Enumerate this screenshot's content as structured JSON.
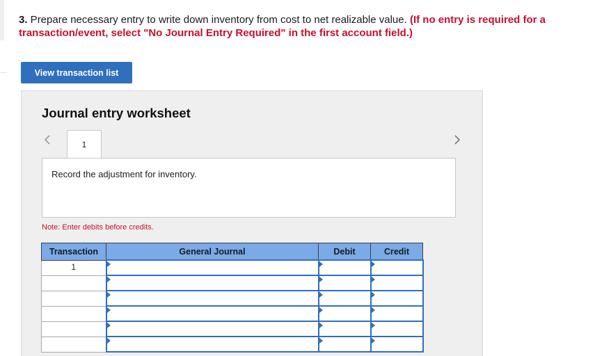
{
  "question": {
    "number": "3.",
    "text": " Prepare necessary entry to write down inventory from cost to net realizable value. ",
    "instruction": "(If no entry is required for a transaction/event, select \"No Journal Entry Required\" in the first account field.)"
  },
  "view_button": {
    "label": "View transaction list"
  },
  "worksheet": {
    "title": "Journal entry worksheet",
    "nav_prev_icon": "chevron-left-icon",
    "nav_next_icon": "chevron-right-icon",
    "active_tab": "1",
    "description": "Record the adjustment for inventory.",
    "note": "Note: Enter debits before credits.",
    "table": {
      "headers": {
        "transaction": "Transaction",
        "journal": "General Journal",
        "debit": "Debit",
        "credit": "Credit"
      },
      "rows": [
        {
          "transaction": "1",
          "account": "",
          "debit": "",
          "credit": ""
        },
        {
          "transaction": "",
          "account": "",
          "debit": "",
          "credit": ""
        },
        {
          "transaction": "",
          "account": "",
          "debit": "",
          "credit": ""
        },
        {
          "transaction": "",
          "account": "",
          "debit": "",
          "credit": ""
        },
        {
          "transaction": "",
          "account": "",
          "debit": "",
          "credit": ""
        },
        {
          "transaction": "",
          "account": "",
          "debit": "",
          "credit": ""
        }
      ]
    }
  },
  "colors": {
    "accent": "#2f6fbd",
    "header_fill": "#7aaae8",
    "instruction": "#c8102e"
  }
}
